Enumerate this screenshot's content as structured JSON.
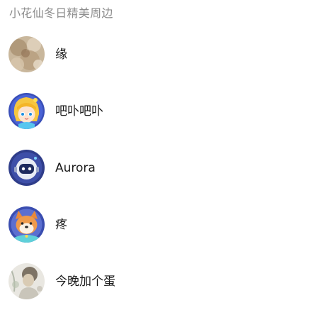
{
  "header": {
    "title": "小花仙冬日精美周边"
  },
  "users": [
    {
      "name": "缘",
      "avatar": "photo-avatar-beige"
    },
    {
      "name": "吧卟吧卟",
      "avatar": "anime-girl-avatar"
    },
    {
      "name": "Aurora",
      "avatar": "robot-avatar"
    },
    {
      "name": "疼",
      "avatar": "shiba-dog-avatar"
    },
    {
      "name": "今晚加个蛋",
      "avatar": "photo-avatar-sketch"
    }
  ]
}
